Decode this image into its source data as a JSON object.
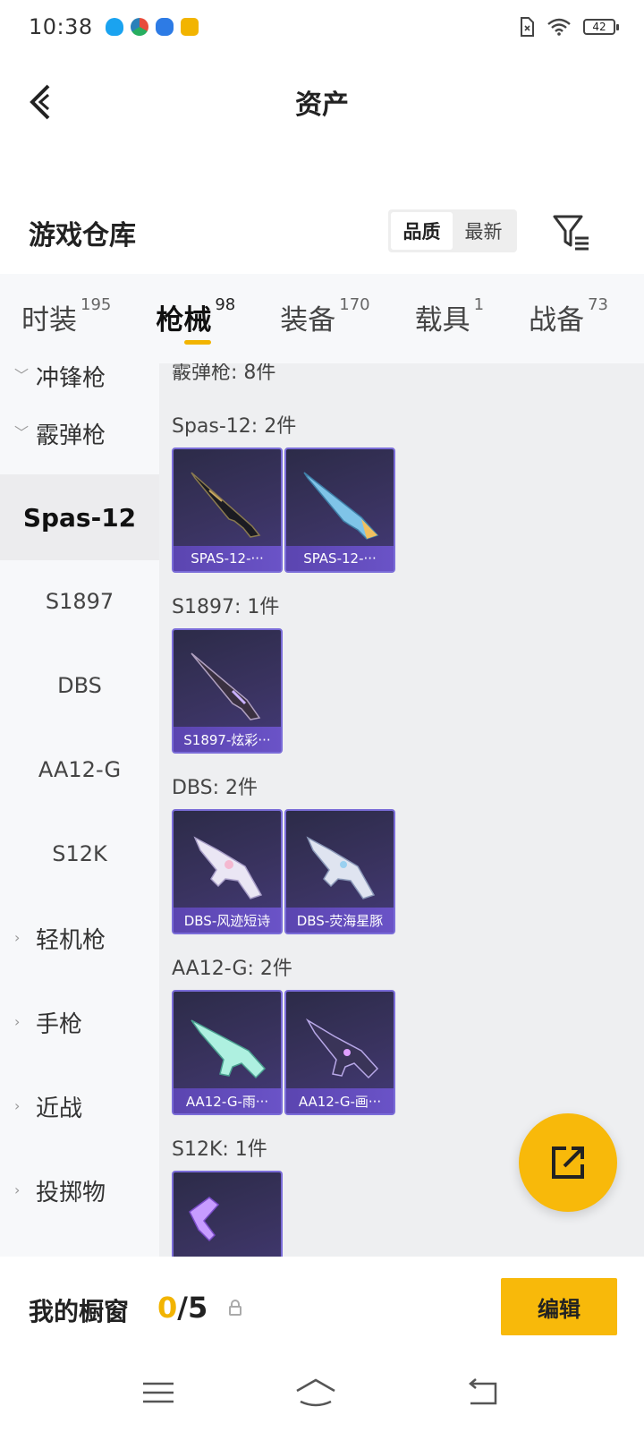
{
  "status_bar": {
    "time": "10:38",
    "battery": "42"
  },
  "nav": {
    "title": "资产"
  },
  "warehouse": {
    "title": "游戏仓库",
    "sort_quality": "品质",
    "sort_latest": "最新"
  },
  "tabs": [
    {
      "label": "时装",
      "count": "195"
    },
    {
      "label": "枪械",
      "count": "98"
    },
    {
      "label": "装备",
      "count": "170"
    },
    {
      "label": "载具",
      "count": "1"
    },
    {
      "label": "战备",
      "count": "73"
    }
  ],
  "sidebar": {
    "cut_top": "冲锋枪",
    "shotgun": "霰弹枪",
    "items": [
      "Spas-12",
      "S1897",
      "DBS",
      "AA12-G",
      "S12K"
    ],
    "lmg": "轻机枪",
    "pistol": "手枪",
    "melee": "近战",
    "throwable": "投掷物"
  },
  "main": {
    "header": "霰弹枪: 8件",
    "sections": [
      {
        "title": "Spas-12: 2件",
        "cards": [
          "SPAS-12-···",
          "SPAS-12-···"
        ]
      },
      {
        "title": "S1897: 1件",
        "cards": [
          "S1897-炫彩···"
        ]
      },
      {
        "title": "DBS: 2件",
        "cards": [
          "DBS-风迹短诗",
          "DBS-荧海星豚"
        ]
      },
      {
        "title": "AA12-G: 2件",
        "cards": [
          "AA12-G-雨···",
          "AA12-G-画···"
        ]
      },
      {
        "title": "S12K: 1件",
        "cards": []
      }
    ]
  },
  "bottom": {
    "label": "我的橱窗",
    "current": "0",
    "total": "/5",
    "edit": "编辑"
  },
  "colors": {
    "accent": "#f8b90a",
    "card_border": "#7a6cd8",
    "card_label": "#5b45b0"
  }
}
